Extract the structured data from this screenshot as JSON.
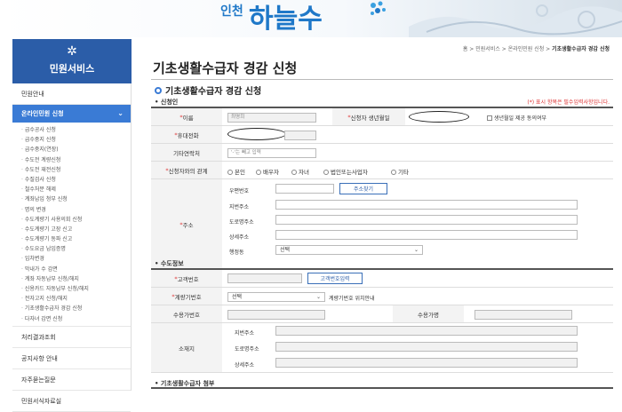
{
  "banner": {
    "logo_small": "인천",
    "logo_big": "하늘수"
  },
  "sidebar": {
    "header_title": "민원서비스",
    "header_icon": "gear-icon",
    "item_intro": "민원안내",
    "active_label": "온라인민원 신청",
    "sub_items": [
      "급수공사 신청",
      "급수중지 신청",
      "급수중지(연장)",
      "수도전 계량신청",
      "수도전 재전신청",
      "수질검사 신청",
      "철수처분 해제",
      "계좌납입 청부 신청",
      "명의 변경",
      "수도계량기 사용의회 신청",
      "수도계량기 고장 신고",
      "수도계량기 동파 신고",
      "수도요금 납입증명",
      "임차변경",
      "막내가 수 감면",
      "계좌 자동납부 신청/해지",
      "신용카드 자동납부 신청/해지",
      "전자고지 신청/해지",
      "기초생활수급자 경감 신청",
      "다자녀 감면 신청"
    ],
    "items_bottom": [
      "처리결과조회",
      "공지사항 안내",
      "자주묻는질문",
      "민원서식자료실"
    ]
  },
  "main": {
    "breadcrumb": [
      "홈",
      "민원서비스",
      "온라인민원 신청"
    ],
    "breadcrumb_current": "기초생활수급자 경감 신청",
    "page_title": "기초생활수급자 경감 신청",
    "sub_title": "기초생활수급자 경감 신청",
    "section_applicant": "신청인",
    "required_note": "(*) 표시 항목은 필수입력사항입니다.",
    "section_water": "수도정보",
    "section_attach": "기초생활수급자 첨부"
  },
  "applicant": {
    "name_label": "이름",
    "name_value": "최명희",
    "birth_label": "신청자 생년월일",
    "birth_consent": "생년월일 제공 동의여부",
    "phone_label": "휴대전화",
    "other_contact_label": "기타연락처",
    "other_contact_placeholder": "'-'는 빼고 입력",
    "relation_label": "신청자와의 관계",
    "relation_options": [
      "본인",
      "배우자",
      "자녀",
      "법인또는사업자",
      "기타"
    ],
    "address_label": "주소",
    "zip_label": "우편번호",
    "zip_button": "주소찾기",
    "lot_label": "지번주소",
    "road_label": "도로명주소",
    "detail_label": "상세주소",
    "dong_label": "행정동",
    "dong_value": "선택"
  },
  "water": {
    "customer_label": "고객번호",
    "customer_button": "고객번호입력",
    "meter_label": "계량기번호",
    "meter_value": "선택",
    "meter_help": "계량기번호 위치안내",
    "user_no_label": "수용가번호",
    "user_name_label": "수용가명",
    "location_label": "소재지",
    "lot_label": "지번주소",
    "road_label": "도로명주소",
    "detail_label": "상세주소"
  }
}
